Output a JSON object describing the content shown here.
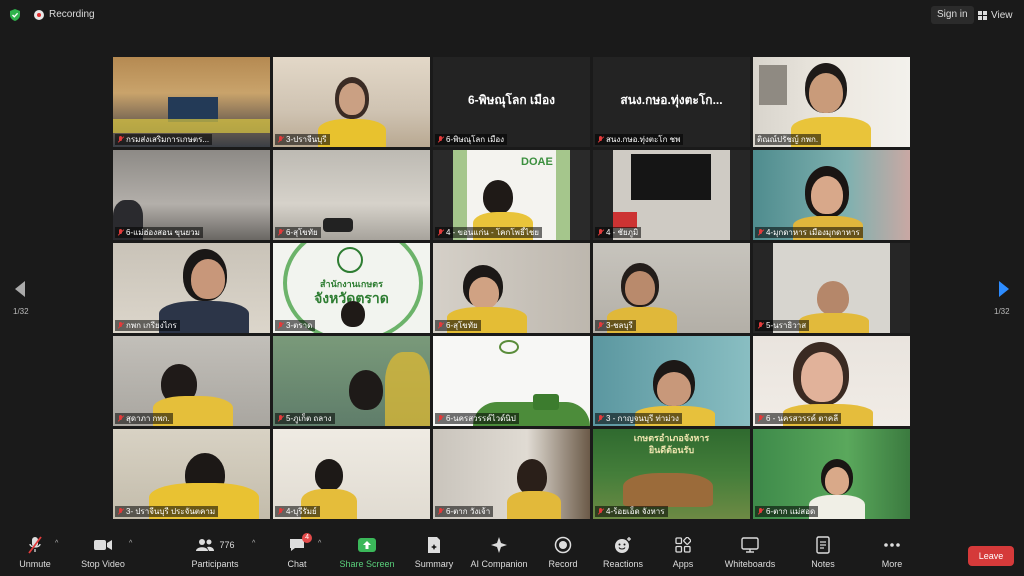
{
  "topbar": {
    "recording_label": "Recording",
    "signin_label": "Sign in",
    "view_label": "View"
  },
  "pagination": {
    "left": "1/32",
    "right": "1/32"
  },
  "tiles": [
    {
      "name": "กรมส่งเสริมการเกษตร..."
    },
    {
      "name": "3-ปราจีนบุรี"
    },
    {
      "name": "6-พิษณุโลก เมือง",
      "display": "6-พิษณุโลก เมือง"
    },
    {
      "name": "สนง.กษอ.ทุ่งตะโก ชพ",
      "display": "สนง.กษอ.ทุ่งตะโก..."
    },
    {
      "name": "ติณณ์ปรัชญ์ กพก."
    },
    {
      "name": "6-แม่ฮ่องสอน ขุนยวม"
    },
    {
      "name": "6-สุโขทัย"
    },
    {
      "name": "4 - ขอนแก่น - โคกโพธิ์ไชย",
      "logo": "DOAE"
    },
    {
      "name": "4 - ชัยภูมิ"
    },
    {
      "name": "4-มุกดาหาร เมืองมุกดาหาร"
    },
    {
      "name": "กพก เกรียงไกร"
    },
    {
      "name": "3-ตราด",
      "sign1": "สำนักงานเกษตร",
      "sign2": "จังหวัดตราด"
    },
    {
      "name": "6-สุโขทัย"
    },
    {
      "name": "3-ชลบุรี"
    },
    {
      "name": "5-นราธิวาส"
    },
    {
      "name": "สุดาภา กพก."
    },
    {
      "name": "5-ภูเก็ต ถลาง"
    },
    {
      "name": "6-นครสวรรค์ไวด์นิป"
    },
    {
      "name": "3 - กาญจนบุรี ท่าม่วง"
    },
    {
      "name": "6 - นครสวรรค์ ตาคลี"
    },
    {
      "name": "3- ปราจีนบุรี ประจันตคาม"
    },
    {
      "name": "4-บุรีรัมย์"
    },
    {
      "name": "6-ตาก วังเจ้า"
    },
    {
      "name": "4-ร้อยเอ็ด จังหาร",
      "sign1": "เกษตรอำเภอจังหาร",
      "sign2": "ยินดีต้อนรับ"
    },
    {
      "name": "6-ตาก แม่สอด"
    }
  ],
  "toolbar": {
    "unmute": "Unmute",
    "stop_video": "Stop Video",
    "participants": "Participants",
    "participants_count": "776",
    "chat": "Chat",
    "chat_badge": "4",
    "share_screen": "Share Screen",
    "summary": "Summary",
    "ai_companion": "AI Companion",
    "record": "Record",
    "reactions": "Reactions",
    "apps": "Apps",
    "whiteboards": "Whiteboards",
    "notes": "Notes",
    "more": "More",
    "leave": "Leave"
  },
  "colors": {
    "accent_green": "#5ad07b",
    "leave_red": "#d53a3a",
    "active_border": "#b9e05a",
    "muted_red": "#e23b3b"
  }
}
